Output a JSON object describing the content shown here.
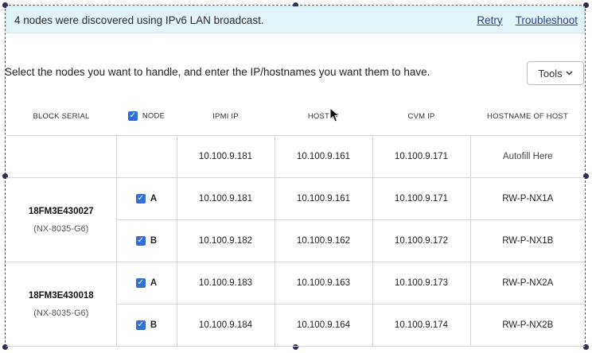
{
  "banner": {
    "message": "4 nodes were discovered using IPv6 LAN broadcast.",
    "retry_label": "Retry",
    "troubleshoot_label": "Troubleshoot"
  },
  "instructions": "Select the nodes you want to handle, and enter the IP/hostnames you want them to have.",
  "tools": {
    "label": "Tools",
    "icon": "chevron-down-icon"
  },
  "table": {
    "headers": {
      "block_serial": "BLOCK SERIAL",
      "node": "NODE",
      "ipmi_ip": "IPMI IP",
      "host_ip": "HOST IP",
      "cvm_ip": "CVM IP",
      "hostname": "HOSTNAME OF HOST"
    },
    "autofill_row": {
      "ipmi_ip": "10.100.9.181",
      "host_ip": "10.100.9.161",
      "cvm_ip": "10.100.9.171",
      "hostname": "Autofill Here"
    },
    "blocks": [
      {
        "serial": "18FM3E430027",
        "model": "(NX-8035-G6)",
        "nodes": [
          {
            "node": "A",
            "ipmi_ip": "10.100.9.181",
            "host_ip": "10.100.9.161",
            "cvm_ip": "10.100.9.171",
            "hostname": "RW-P-NX1A"
          },
          {
            "node": "B",
            "ipmi_ip": "10.100.9.182",
            "host_ip": "10.100.9.162",
            "cvm_ip": "10.100.9.172",
            "hostname": "RW-P-NX1B"
          }
        ]
      },
      {
        "serial": "18FM3E430018",
        "model": "(NX-8035-G6)",
        "nodes": [
          {
            "node": "A",
            "ipmi_ip": "10.100.9.183",
            "host_ip": "10.100.9.163",
            "cvm_ip": "10.100.9.173",
            "hostname": "RW-P-NX2A"
          },
          {
            "node": "B",
            "ipmi_ip": "10.100.9.184",
            "host_ip": "10.100.9.164",
            "cvm_ip": "10.100.9.174",
            "hostname": "RW-P-NX2B"
          }
        ]
      }
    ]
  },
  "colors": {
    "banner_bg": "#e3f4f8",
    "link": "#2a3f8f",
    "checkbox": "#2f6fd6"
  }
}
